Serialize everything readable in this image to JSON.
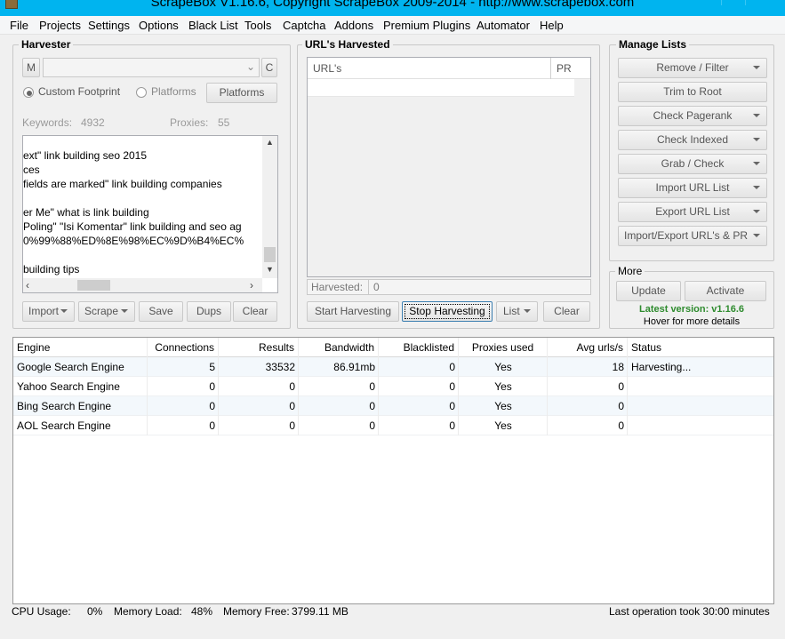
{
  "window": {
    "title": "ScrapeBox V1.16.6, Copyright ScrapeBox 2009-2014 - http://www.scrapebox.com"
  },
  "menu": [
    "File",
    "Projects",
    "Settings",
    "Options",
    "Black List",
    "Tools",
    "Captcha",
    "Addons",
    "Premium Plugins",
    "Automator",
    "Help"
  ],
  "harvester": {
    "group_label": "Harvester",
    "m_label": "M",
    "c_label": "C",
    "custom_footprint_label": "Custom Footprint",
    "platforms_radio_label": "Platforms",
    "platforms_button": "Platforms",
    "keywords_label": "Keywords:",
    "keywords_count": "4932",
    "proxies_label": "Proxies:",
    "proxies_count": "55",
    "keywords_lines": [
      "ext\" link building seo 2015",
      "ces",
      " fields are marked\" link building companies",
      "",
      "er Me\" what is link building",
      "Poling\" \"Isi Komentar\" link building and seo ag",
      "0%99%88%ED%8E%98%EC%9D%B4%EC%",
      "",
      "building tips"
    ],
    "buttons": {
      "import": "Import",
      "scrape": "Scrape",
      "save": "Save",
      "dups": "Dups",
      "clear": "Clear"
    }
  },
  "urls": {
    "group_label": "URL's Harvested",
    "col_url": "URL's",
    "col_pr": "PR",
    "harvested_label": "Harvested:",
    "harvested_count": "0",
    "buttons": {
      "start": "Start Harvesting",
      "stop": "Stop Harvesting",
      "list": "List",
      "clear": "Clear"
    }
  },
  "manage": {
    "group_label": "Manage Lists",
    "buttons": [
      {
        "label": "Remove / Filter",
        "dropdown": true
      },
      {
        "label": "Trim to Root",
        "dropdown": false
      },
      {
        "label": "Check Pagerank",
        "dropdown": true
      },
      {
        "label": "Check Indexed",
        "dropdown": true
      },
      {
        "label": "Grab / Check",
        "dropdown": true
      },
      {
        "label": "Import URL List",
        "dropdown": true
      },
      {
        "label": "Export URL List",
        "dropdown": true
      },
      {
        "label": "Import/Export URL's & PR",
        "dropdown": true
      }
    ]
  },
  "more": {
    "group_label": "More",
    "update": "Update",
    "activate": "Activate",
    "latest_version": "Latest version: v1.16.6",
    "hover_text": "Hover for more details",
    "latest_color": "#2e8b2e"
  },
  "engines": {
    "headers": [
      "Engine",
      "Connections",
      "Results",
      "Bandwidth",
      "Blacklisted",
      "Proxies used",
      "Avg urls/s",
      "Status"
    ],
    "rows": [
      [
        "Google Search Engine",
        "5",
        "33532",
        "86.91mb",
        "0",
        "Yes",
        "18",
        "Harvesting..."
      ],
      [
        "Yahoo Search Engine",
        "0",
        "0",
        "0",
        "0",
        "Yes",
        "0",
        ""
      ],
      [
        "Bing Search Engine",
        "0",
        "0",
        "0",
        "0",
        "Yes",
        "0",
        ""
      ],
      [
        "AOL Search Engine",
        "0",
        "0",
        "0",
        "0",
        "Yes",
        "0",
        ""
      ]
    ]
  },
  "status": {
    "cpu_label": "CPU Usage:",
    "cpu_value": "0%",
    "mem_load_label": "Memory Load:",
    "mem_load_value": "48%",
    "mem_free_label": "Memory Free:",
    "mem_free_value": "3799.11 MB",
    "last_op": "Last operation took 30:00 minutes"
  }
}
